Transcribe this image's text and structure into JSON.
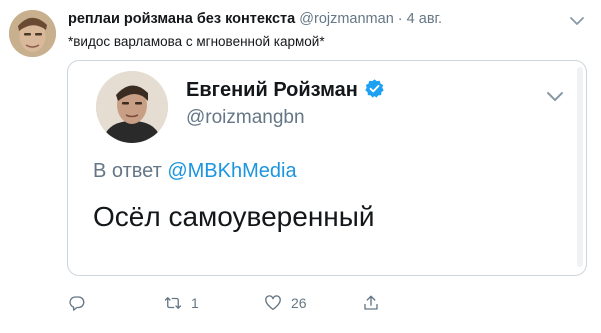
{
  "tweet": {
    "author_name": "реплаи ройзмана без контекста",
    "author_handle": "@rojzmanman",
    "separator": "·",
    "date": "4 авг.",
    "text": "*видос варламова с мгновенной кармой*"
  },
  "quoted": {
    "name": "Евгений Ройзман",
    "handle": "@roizmangbn",
    "reply_prefix": "В ответ",
    "reply_mention": "@MBKhMedia",
    "text": "Осёл самоуверенный"
  },
  "actions": {
    "retweet_count": "1",
    "like_count": "26"
  },
  "colors": {
    "accent": "#1b95e0",
    "verified": "#1da1f2",
    "muted": "#657786",
    "border": "#ccd6dd"
  },
  "icons": [
    "chevron-down-icon",
    "verified-badge-icon",
    "reply-icon",
    "retweet-icon",
    "like-icon",
    "share-icon"
  ]
}
